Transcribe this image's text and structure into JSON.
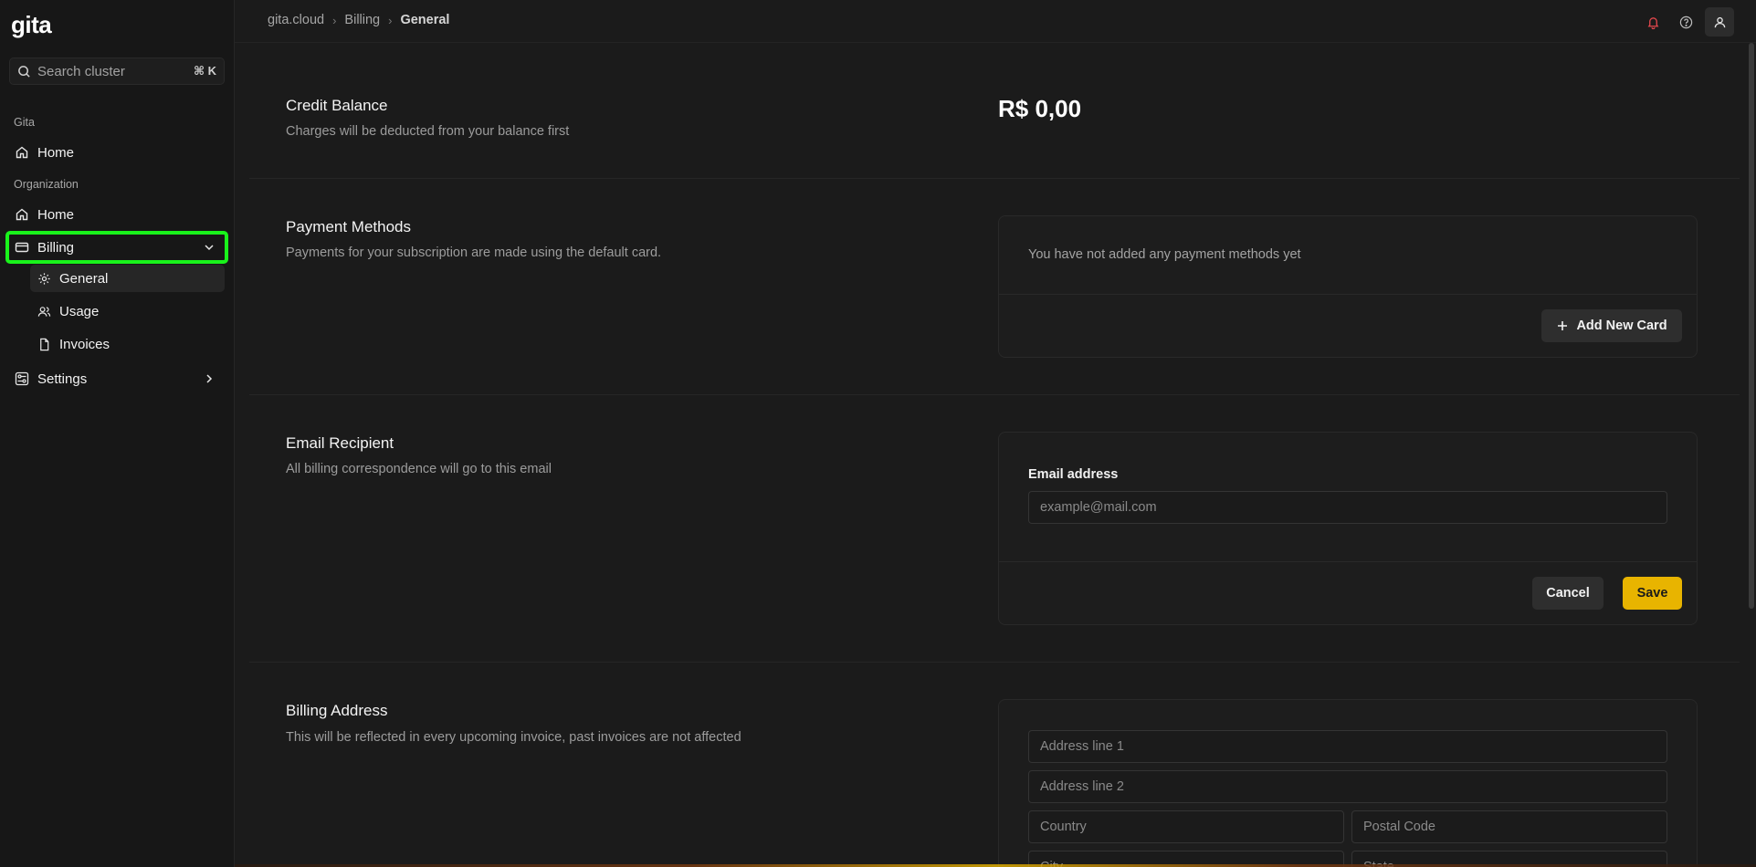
{
  "sidebar": {
    "logo": {
      "text": "gita"
    },
    "search": {
      "placeholder": "Search cluster",
      "shortcut": "⌘ K"
    },
    "sections": [
      {
        "label": "Gita",
        "items": [
          {
            "label": "Home",
            "icon": "home-icon"
          }
        ]
      },
      {
        "label": "Organization",
        "items": [
          {
            "label": "Home",
            "icon": "home-icon"
          },
          {
            "label": "Billing",
            "icon": "credit-card-icon",
            "expanded": true,
            "children": [
              {
                "label": "General",
                "icon": "gear-icon",
                "active": true
              },
              {
                "label": "Usage",
                "icon": "users-icon"
              },
              {
                "label": "Invoices",
                "icon": "file-icon"
              }
            ]
          },
          {
            "label": "Settings",
            "icon": "settings-icon"
          }
        ]
      }
    ]
  },
  "breadcrumb": [
    "gita.cloud",
    "Billing",
    "General"
  ],
  "topbar": {
    "icons": [
      "bell-icon",
      "help-icon",
      "user-icon"
    ]
  },
  "credit": {
    "title": "Credit Balance",
    "desc": "Charges will be deducted from your balance first",
    "value": "R$ 0,00"
  },
  "payment": {
    "title": "Payment Methods",
    "desc": "Payments for your subscription are made using the default card.",
    "empty": "You have not added any payment methods yet",
    "add_label": "Add New Card"
  },
  "email": {
    "title": "Email Recipient",
    "desc": "All billing correspondence will go to this email",
    "field_label": "Email address",
    "placeholder": "example@mail.com",
    "cancel_label": "Cancel",
    "save_label": "Save"
  },
  "address": {
    "title": "Billing Address",
    "desc": "This will be reflected in every upcoming invoice, past invoices are not affected",
    "line1_ph": "Address line 1",
    "line2_ph": "Address line 2",
    "country_ph": "Country",
    "postal_ph": "Postal Code",
    "city_ph": "City",
    "state_ph": "State"
  },
  "colors": {
    "accent": "#e8b400",
    "highlight": "#19f21b",
    "notification": "#e5484d"
  }
}
